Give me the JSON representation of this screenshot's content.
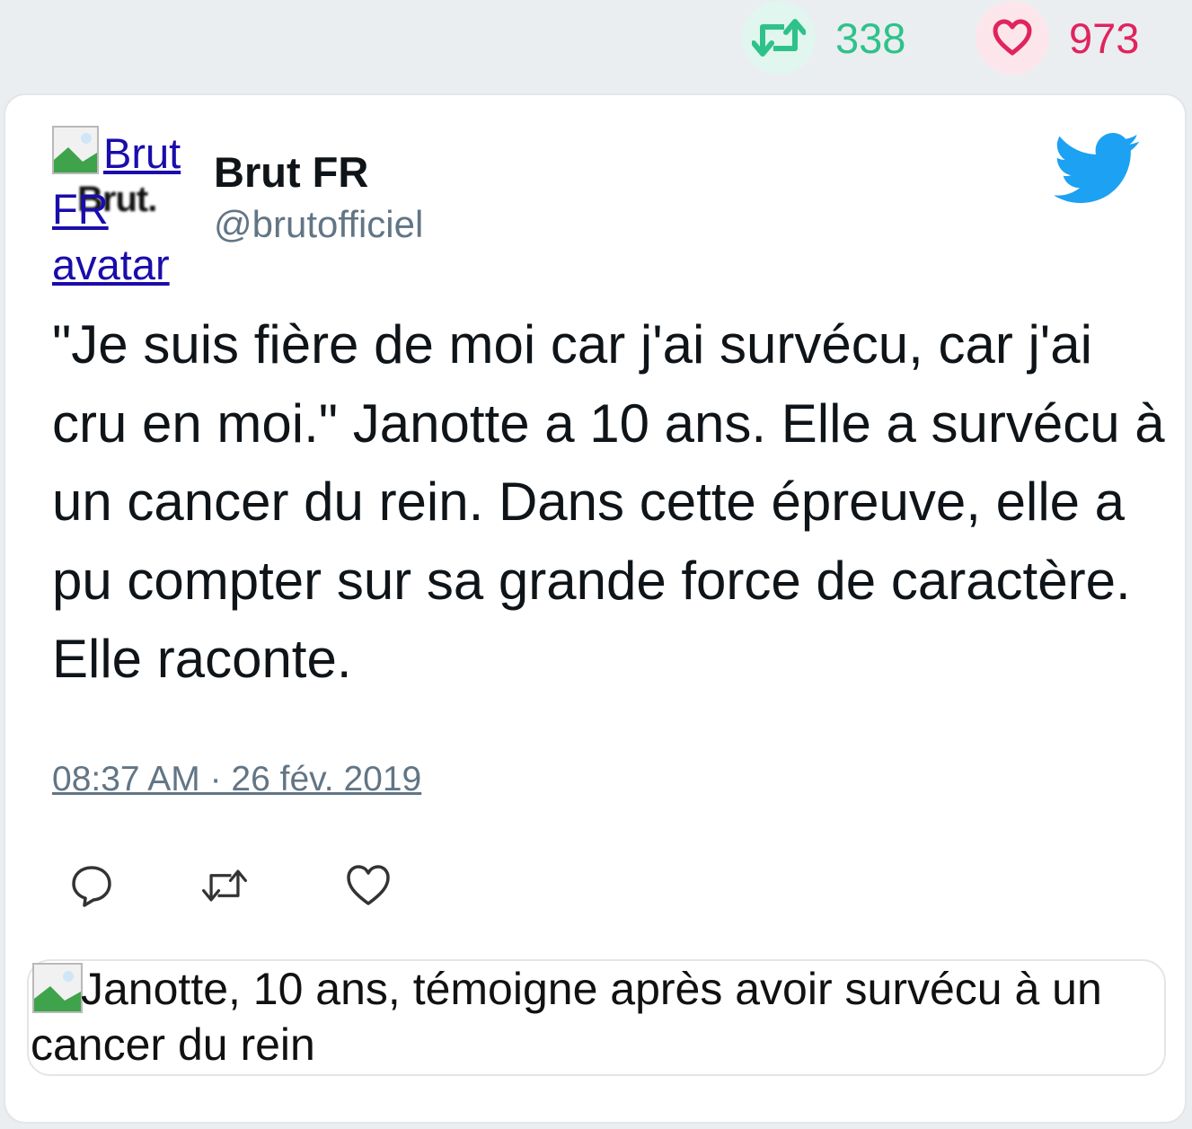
{
  "stats": {
    "retweets": "338",
    "likes": "973"
  },
  "colors": {
    "retweet": "#2ec28a",
    "like": "#e0245e",
    "twitter_blue": "#1da1f2",
    "muted": "#627585"
  },
  "tweet": {
    "avatar_alt": [
      "Brut",
      "FR",
      "avatar"
    ],
    "avatar_logo_text": "Brut.",
    "name": "Brut FR",
    "handle": "@brutofficiel",
    "text": "\"Je suis fière de moi car j'ai survécu, car j'ai cru en moi.\" Janotte a 10 ans. Elle a survécu à un cancer du rein. Dans cette épreuve, elle a pu compter sur sa grande force de caractère. Elle raconte.",
    "timestamp": "08:37 AM · 26 fév. 2019",
    "media_caption": "Janotte, 10 ans, témoigne après avoir survécu à un cancer du rein"
  },
  "icons": [
    "retweet-icon",
    "heart-icon",
    "twitter-bird-icon",
    "reply-icon",
    "broken-image-icon"
  ]
}
